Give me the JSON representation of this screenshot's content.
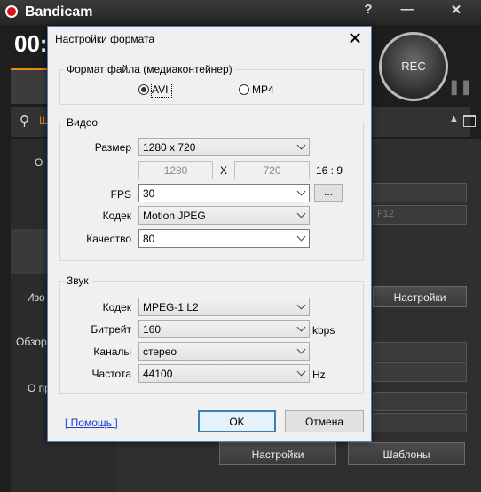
{
  "bandicam": {
    "app_title": "Bandicam",
    "help_btn": "?",
    "minimize_btn": "—",
    "close_btn": "✕",
    "timer": "00:",
    "rec_label": "REC",
    "search_text": "Ш",
    "left_labels": [
      "О",
      "Изо",
      "Обзор",
      "О пр"
    ],
    "hotkey_text": "F12",
    "settings_button": "Настройки",
    "bottom_buttons": [
      "Настройки",
      "Шаблоны"
    ]
  },
  "dialog": {
    "title": "Настройки формата",
    "close": "✕",
    "file_format": {
      "legend": "Формат файла (медиаконтейнер)",
      "options": [
        {
          "label": "AVI",
          "selected": true
        },
        {
          "label": "MP4",
          "selected": false
        }
      ]
    },
    "video": {
      "legend": "Видео",
      "size_label": "Размер",
      "size_value": "1280 x 720",
      "width": "1280",
      "x_sep": "X",
      "height": "720",
      "aspect": "16 : 9",
      "fps_label": "FPS",
      "fps_value": "30",
      "more_btn": "...",
      "codec_label": "Кодек",
      "codec_value": "Motion JPEG",
      "quality_label": "Качество",
      "quality_value": "80"
    },
    "audio": {
      "legend": "Звук",
      "codec_label": "Кодек",
      "codec_value": "MPEG-1 L2",
      "bitrate_label": "Битрейт",
      "bitrate_value": "160",
      "bitrate_unit": "kbps",
      "channels_label": "Каналы",
      "channels_value": "стерео",
      "freq_label": "Частота",
      "freq_value": "44100",
      "freq_unit": "Hz"
    },
    "help_link": "[ Помощь ]",
    "ok": "OK",
    "cancel": "Отмена"
  }
}
